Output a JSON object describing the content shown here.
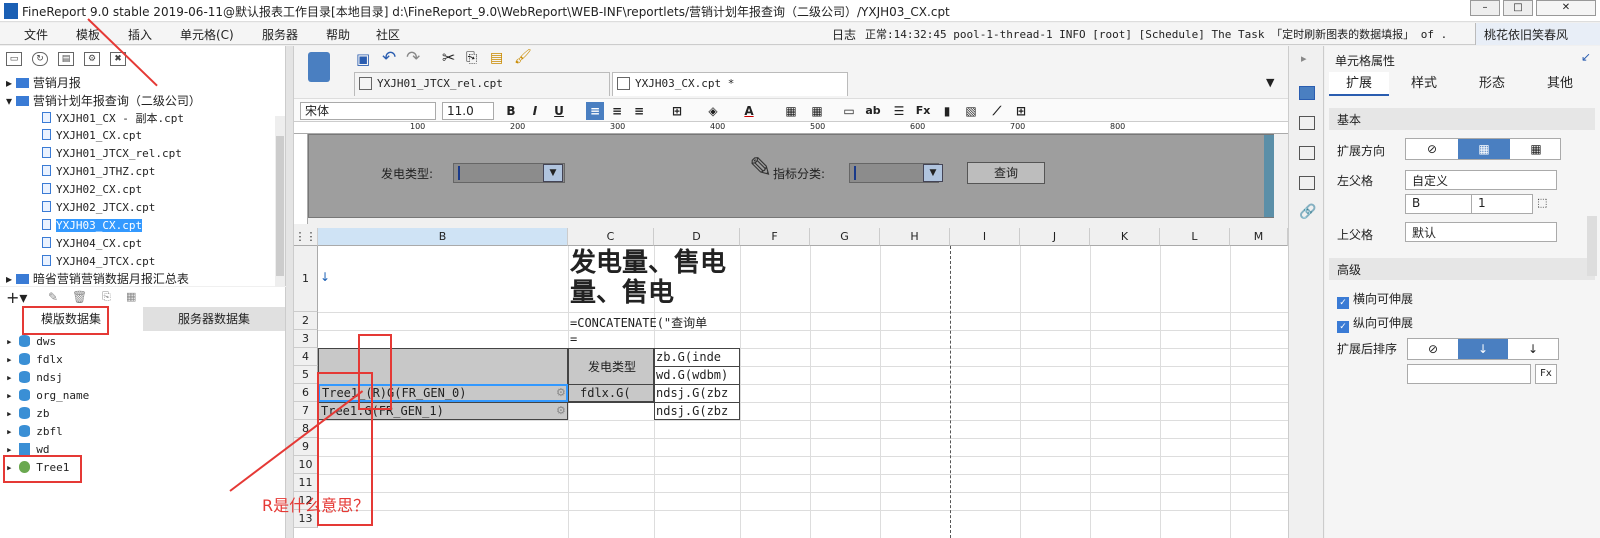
{
  "title": "FineReport 9.0 stable 2019-06-11@默认报表工作目录[本地目录]    d:\\FineReport_9.0\\WebReport\\WEB-INF\\reportlets/营销计划年报查询（二级公司）/YXJH03_CX.cpt",
  "menu": [
    "文件",
    "模板",
    "插入",
    "单元格(C)",
    "服务器",
    "帮助",
    "社区"
  ],
  "log": {
    "label": "日志",
    "text": "正常:14:32:45 pool-1-thread-1 INFO [root] [Schedule] The Task 「定时刷新图表的数据填报」 of ..."
  },
  "user": "桃花依旧笑春风",
  "tree": [
    {
      "label": "营销月报",
      "type": "folder"
    },
    {
      "label": "营销计划年报查询（二级公司）",
      "type": "folder"
    },
    {
      "label": "YXJH01_CX - 副本.cpt",
      "type": "file"
    },
    {
      "label": "YXJH01_CX.cpt",
      "type": "file"
    },
    {
      "label": "YXJH01_JTCX_rel.cpt",
      "type": "file"
    },
    {
      "label": "YXJH01_JTHZ.cpt",
      "type": "file"
    },
    {
      "label": "YXJH02_CX.cpt",
      "type": "file"
    },
    {
      "label": "YXJH02_JTCX.cpt",
      "type": "file"
    },
    {
      "label": "YXJH03_CX.cpt",
      "type": "file",
      "selected": true
    },
    {
      "label": "YXJH04_CX.cpt",
      "type": "file"
    },
    {
      "label": "YXJH04_JTCX.cpt",
      "type": "file"
    },
    {
      "label": "暗省营销营销数据月报汇总表",
      "type": "folder"
    }
  ],
  "datasetTabs": [
    "模版数据集",
    "服务器数据集"
  ],
  "datasets": [
    "dws",
    "fdlx",
    "ndsj",
    "org_name",
    "zb",
    "zbfl",
    "wd",
    "Tree1"
  ],
  "fileTabs": [
    "YXJH01_JTCX_rel.cpt",
    "YXJH03_CX.cpt *"
  ],
  "font": {
    "name": "宋体",
    "size": "11.0"
  },
  "ruler": [
    "100",
    "200",
    "300",
    "400",
    "500",
    "600",
    "700",
    "800"
  ],
  "params": {
    "label1": "发电类型:",
    "label2": "指标分类:",
    "query": "查询"
  },
  "columns": [
    "B",
    "C",
    "D",
    "F",
    "G",
    "H",
    "I",
    "J",
    "K",
    "L",
    "M"
  ],
  "rows": [
    "1",
    "2",
    "3",
    "4",
    "5",
    "6",
    "7",
    "8",
    "9",
    "10",
    "11",
    "12",
    "13"
  ],
  "cells": {
    "c1": "发电量、售电量、售电",
    "c2": "=CONCATENATE(\"查询单",
    "c3": "=",
    "c6label": "发电类型",
    "d4": "zb.G(inde",
    "d5": "wd.G(wdbm)",
    "b6": "Tree1_(R)G(FR_GEN_0)",
    "c6": "fdlx.G(",
    "d6": "ndsj.G(zbz",
    "b7": "Tree1.G(FR_GEN_1)",
    "d7": "ndsj.G(zbz"
  },
  "props": {
    "title": "单元格属性",
    "tabs": [
      "扩展",
      "样式",
      "形态",
      "其他"
    ],
    "basic": "基本",
    "dir": "扩展方向",
    "leftParent": "左父格",
    "leftValue": "自定义",
    "leftCol": "B",
    "leftRow": "1",
    "upParent": "上父格",
    "upValue": "默认",
    "advanced": "高级",
    "hExpand": "横向可伸展",
    "vExpand": "纵向可伸展",
    "sort": "扩展后排序"
  },
  "annotation": "R是什么意思？"
}
